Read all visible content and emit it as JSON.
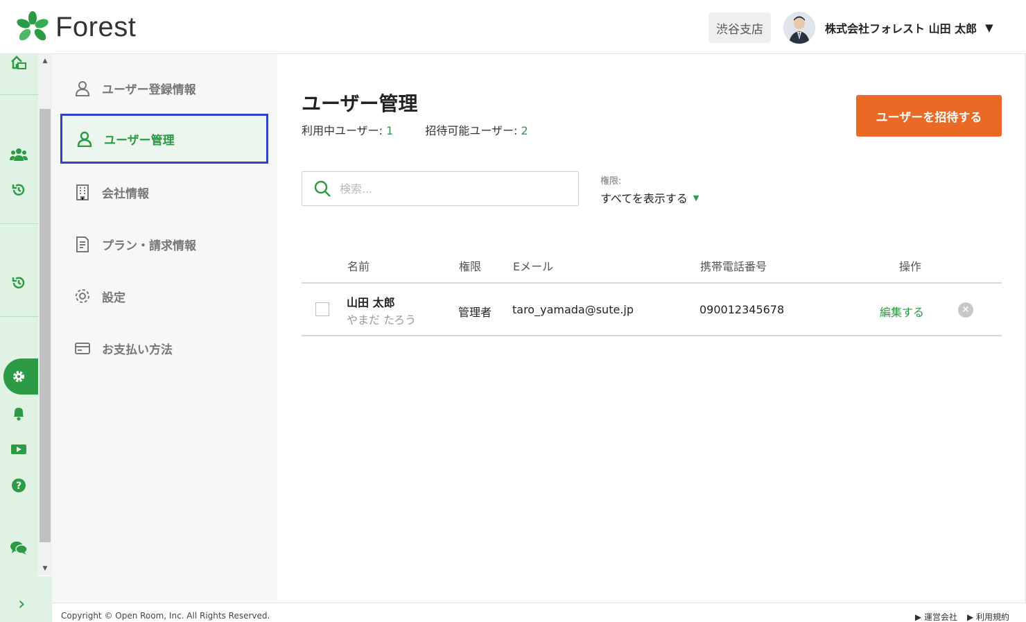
{
  "header": {
    "logo_text": "Forest",
    "branch": "渋谷支店",
    "user_name": "株式会社フォレスト 山田 太郎",
    "caret": "▼"
  },
  "rail": {
    "icons": [
      "home-icon",
      "users-icon",
      "history-icon",
      "history-icon-2",
      "settings-icon",
      "bell-icon",
      "video-icon",
      "help-icon",
      "chat-icon"
    ],
    "expand": "›"
  },
  "subnav": {
    "items": [
      {
        "label": "ユーザー登録情報",
        "icon": "user-icon"
      },
      {
        "label": "ユーザー管理",
        "icon": "user-icon",
        "active": true
      },
      {
        "label": "会社情報",
        "icon": "building-icon"
      },
      {
        "label": "プラン・請求情報",
        "icon": "invoice-icon"
      },
      {
        "label": "設定",
        "icon": "gear-icon"
      },
      {
        "label": "お支払い方法",
        "icon": "credit-card-icon"
      }
    ]
  },
  "main": {
    "title": "ユーザー管理",
    "stats": {
      "active_label": "利用中ユーザー: ",
      "active_count": "1",
      "invitable_label": "招待可能ユーザー: ",
      "invitable_count": "2"
    },
    "invite_button": "ユーザーを招待する",
    "search_placeholder": "検索...",
    "filter_label": "権限:",
    "filter_value": "すべてを表示する",
    "table": {
      "headers": [
        "名前",
        "権限",
        "Eメール",
        "携帯電話番号",
        "操作"
      ],
      "rows": [
        {
          "name": "山田 太郎",
          "kana": "やまだ たろう",
          "role": "管理者",
          "email": "taro_yamada@sute.jp",
          "phone": "090012345678",
          "edit": "編集する",
          "delete": "×"
        }
      ]
    }
  },
  "footer": {
    "copyright": "Copyright © Open Room, Inc. All Rights Reserved.",
    "links": [
      "▶ 運営会社",
      "▶ 利用規約"
    ]
  },
  "colors": {
    "accent": "#2d9a46",
    "button": "#ea6a25",
    "active_border": "#3340c8",
    "rail_bg": "#e0f2e4"
  }
}
